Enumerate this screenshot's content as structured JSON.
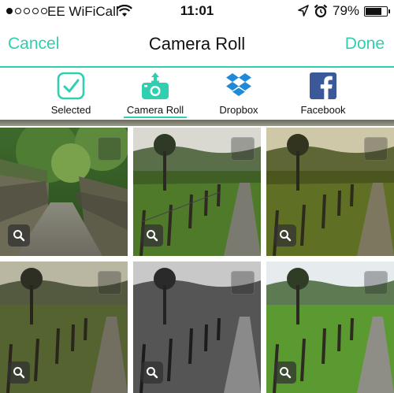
{
  "status_bar": {
    "carrier": "EE WiFiCall",
    "time": "11:01",
    "battery": "79%",
    "battery_level": 0.79,
    "signal_bars_filled": 1,
    "signal_bars_total": 5
  },
  "nav": {
    "cancel_label": "Cancel",
    "title": "Camera Roll",
    "done_label": "Done"
  },
  "tabs": [
    {
      "label": "Selected",
      "icon": "checkbox-icon"
    },
    {
      "label": "Camera Roll",
      "icon": "camera-upload-icon",
      "active": true
    },
    {
      "label": "Dropbox",
      "icon": "dropbox-icon"
    },
    {
      "label": "Facebook",
      "icon": "facebook-icon"
    }
  ],
  "colors": {
    "accent": "#2fcfb0",
    "dropbox": "#1f8ad9",
    "facebook": "#3b5998"
  },
  "photos": [
    {
      "name": "photo-stone-bridge",
      "style": "color"
    },
    {
      "name": "photo-field-fence-1",
      "style": "color"
    },
    {
      "name": "photo-field-fence-2",
      "style": "warm"
    },
    {
      "name": "photo-field-fence-3",
      "style": "vintage"
    },
    {
      "name": "photo-field-fence-4",
      "style": "mono"
    },
    {
      "name": "photo-field-fence-5",
      "style": "bright"
    }
  ]
}
